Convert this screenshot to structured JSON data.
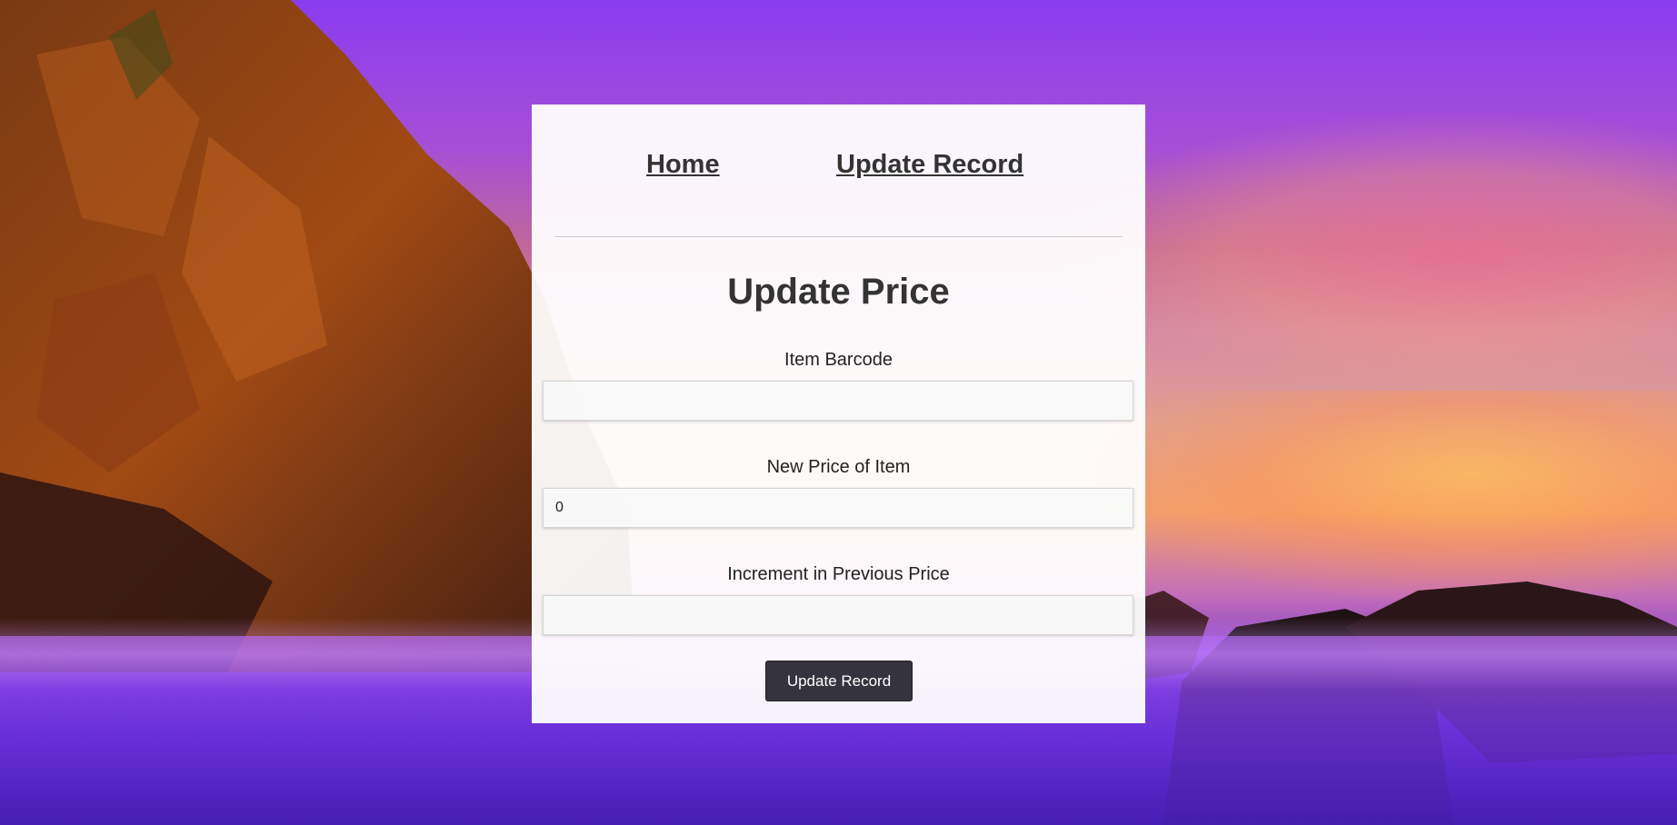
{
  "nav": {
    "home_label": "Home",
    "update_record_label": "Update Record"
  },
  "form": {
    "title": "Update Price",
    "barcode_label": "Item Barcode",
    "barcode_value": "",
    "new_price_label": "New Price of Item",
    "new_price_value": "0",
    "increment_label": "Increment in Previous Price",
    "increment_value": "",
    "submit_label": "Update Record"
  },
  "colors": {
    "button_bg": "#35333d",
    "text": "#333333",
    "card_bg": "#ffffff"
  }
}
